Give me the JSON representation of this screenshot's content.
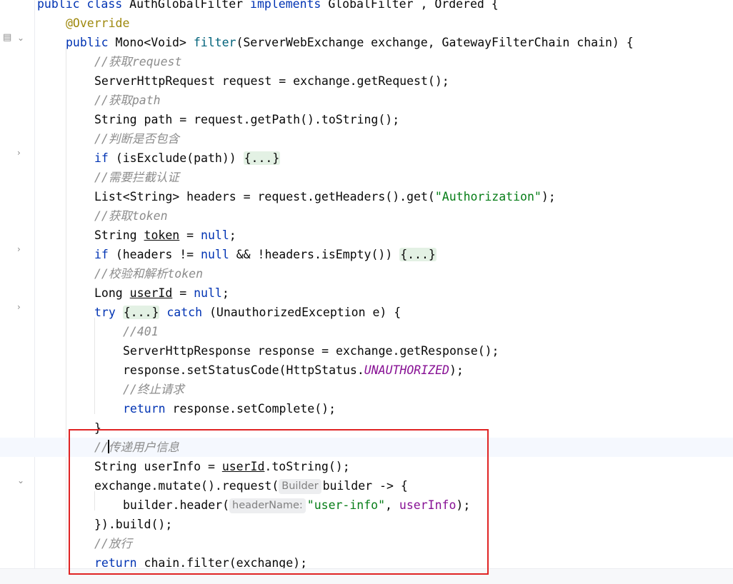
{
  "editor": {
    "lines": [
      {
        "segments": [
          [
            "kw",
            "public class "
          ],
          [
            "plain",
            "AuthGlobalFilter "
          ],
          [
            "kw",
            "implements "
          ],
          [
            "plain",
            "GlobalFilter , Ordered {"
          ]
        ]
      },
      {
        "segments": [
          [
            "ann",
            "@Override"
          ]
        ]
      },
      {
        "segments": [
          [
            "kw",
            "public "
          ],
          [
            "plain",
            "Mono<Void> "
          ],
          [
            "fn",
            "filter"
          ],
          [
            "plain",
            "(ServerWebExchange exchange, GatewayFilterChain chain) {"
          ]
        ]
      },
      {
        "segments": [
          [
            "cm",
            "//获取request"
          ]
        ]
      },
      {
        "segments": [
          [
            "plain",
            "ServerHttpRequest request = exchange.getRequest();"
          ]
        ]
      },
      {
        "segments": [
          [
            "cm",
            "//获取path"
          ]
        ]
      },
      {
        "segments": [
          [
            "plain",
            "String path = request.getPath().toString();"
          ]
        ]
      },
      {
        "segments": [
          [
            "cm",
            "//判断是否包含"
          ]
        ]
      },
      {
        "segments": [
          [
            "kw",
            "if "
          ],
          [
            "plain",
            "(isExclude(path)) "
          ],
          [
            "fold",
            "{...}"
          ]
        ]
      },
      {
        "segments": [
          [
            "cm",
            "//需要拦截认证"
          ]
        ]
      },
      {
        "segments": [
          [
            "plain",
            "List<String> headers = request.getHeaders().get("
          ],
          [
            "str",
            "\"Authorization\""
          ],
          [
            "plain",
            ");"
          ]
        ]
      },
      {
        "segments": [
          [
            "cm",
            "//获取token"
          ]
        ]
      },
      {
        "segments": [
          [
            "plain",
            "String "
          ],
          [
            "ul",
            "token"
          ],
          [
            "plain",
            " = "
          ],
          [
            "kw",
            "null"
          ],
          [
            "plain",
            ";"
          ]
        ]
      },
      {
        "segments": [
          [
            "kw",
            "if "
          ],
          [
            "plain",
            "(headers != "
          ],
          [
            "kw",
            "null "
          ],
          [
            "plain",
            "&& !headers.isEmpty()) "
          ],
          [
            "fold",
            "{...}"
          ]
        ]
      },
      {
        "segments": [
          [
            "cm",
            "//校验和解析token"
          ]
        ]
      },
      {
        "segments": [
          [
            "plain",
            "Long "
          ],
          [
            "ul",
            "userId"
          ],
          [
            "plain",
            " = "
          ],
          [
            "kw",
            "null"
          ],
          [
            "plain",
            ";"
          ]
        ]
      },
      {
        "segments": [
          [
            "kw",
            "try "
          ],
          [
            "fold",
            "{...}"
          ],
          [
            "plain",
            " "
          ],
          [
            "kw",
            "catch "
          ],
          [
            "plain",
            "(UnauthorizedException e) {"
          ]
        ]
      },
      {
        "segments": [
          [
            "cm",
            "//401"
          ]
        ]
      },
      {
        "segments": [
          [
            "plain",
            "ServerHttpResponse response = exchange.getResponse();"
          ]
        ]
      },
      {
        "segments": [
          [
            "plain",
            "response.setStatusCode(HttpStatus."
          ],
          [
            "cnst",
            "UNAUTHORIZED"
          ],
          [
            "plain",
            ");"
          ]
        ]
      },
      {
        "segments": [
          [
            "cm",
            "//终止请求"
          ]
        ]
      },
      {
        "segments": [
          [
            "kw",
            "return "
          ],
          [
            "plain",
            "response.setComplete();"
          ]
        ]
      },
      {
        "segments": [
          [
            "plain",
            "}"
          ]
        ]
      },
      {
        "segments": [
          [
            "cm",
            "//"
          ],
          [
            "caret",
            ""
          ],
          [
            "cm",
            "传递用户信息"
          ]
        ]
      },
      {
        "segments": [
          [
            "plain",
            "String userInfo = "
          ],
          [
            "ul",
            "userId"
          ],
          [
            "plain",
            ".toString();"
          ]
        ]
      },
      {
        "segments": [
          [
            "plain",
            "exchange.mutate().request("
          ],
          [
            "hint",
            "Builder"
          ],
          [
            "plain",
            "builder -> {"
          ]
        ]
      },
      {
        "segments": [
          [
            "plain",
            "builder.header("
          ],
          [
            "hint",
            "headerName:"
          ],
          [
            "str",
            "\"user-info\""
          ],
          [
            "plain",
            ", "
          ],
          [
            "var",
            "userInfo"
          ],
          [
            "plain",
            ");"
          ]
        ]
      },
      {
        "segments": [
          [
            "plain",
            "}).build();"
          ]
        ]
      },
      {
        "segments": [
          [
            "cm",
            "//放行"
          ]
        ]
      },
      {
        "segments": [
          [
            "kw",
            "return "
          ],
          [
            "plain",
            "chain.filter(exchange);"
          ]
        ]
      }
    ]
  },
  "icons": {
    "gutter_implements": "implements-method-icon",
    "fold_expanded": "chevron-down-icon",
    "fold_collapsed": "chevron-right-icon"
  }
}
